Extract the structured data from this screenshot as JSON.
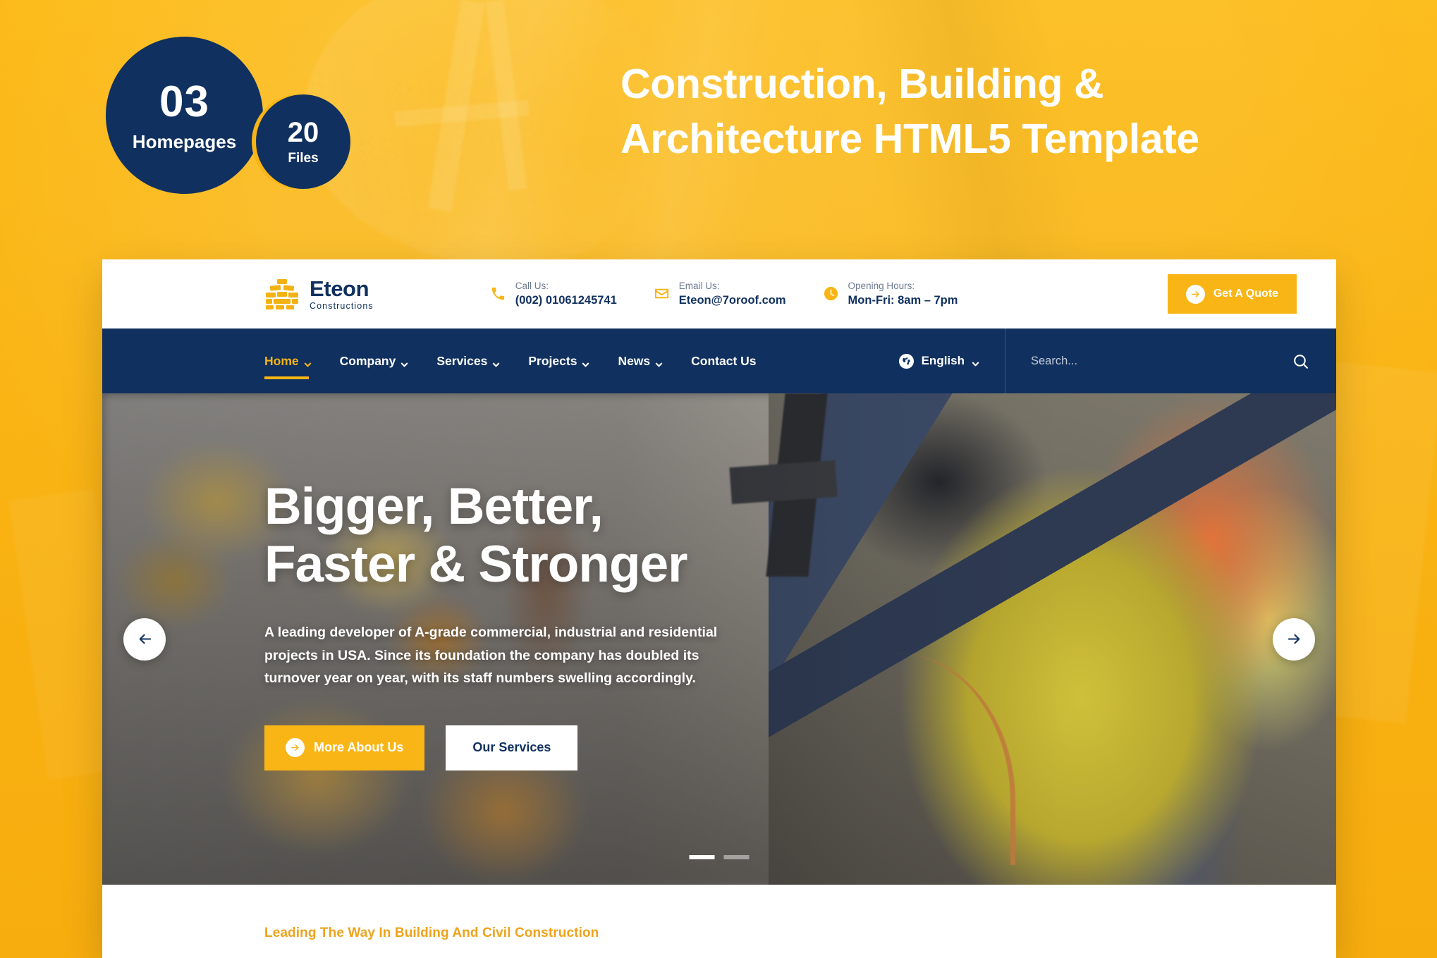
{
  "promo": {
    "badge_primary": {
      "number": "03",
      "label": "Homepages"
    },
    "badge_secondary": {
      "number": "20",
      "label": "Files"
    },
    "title_line1": "Construction, Building &",
    "title_line2": "Architecture HTML5 Template",
    "background_color": "#f9b515",
    "badge_color": "#10305f"
  },
  "site": {
    "logo": {
      "name": "Eteon",
      "tagline": "Constructions",
      "icon": "brick-wall-icon"
    },
    "contacts": [
      {
        "icon": "phone-icon",
        "label": "Call Us:",
        "value": "(002) 01061245741"
      },
      {
        "icon": "mail-icon",
        "label": "Email Us:",
        "value": "Eteon@7oroof.com"
      },
      {
        "icon": "clock-icon",
        "label": "Opening Hours:",
        "value": "Mon-Fri: 8am – 7pm"
      }
    ],
    "quote_button": "Get A Quote",
    "nav": [
      {
        "label": "Home",
        "has_dropdown": true,
        "active": true
      },
      {
        "label": "Company",
        "has_dropdown": true,
        "active": false
      },
      {
        "label": "Services",
        "has_dropdown": true,
        "active": false
      },
      {
        "label": "Projects",
        "has_dropdown": true,
        "active": false
      },
      {
        "label": "News",
        "has_dropdown": true,
        "active": false
      },
      {
        "label": "Contact Us",
        "has_dropdown": false,
        "active": false
      }
    ],
    "language": {
      "label": "English",
      "icon": "globe-icon"
    },
    "search": {
      "placeholder": "Search...",
      "value": "",
      "icon": "search-icon"
    },
    "accent_color": "#f9b515",
    "navbar_color": "#10305f"
  },
  "hero": {
    "title_line1": "Bigger, Better,",
    "title_line2": "Faster & Stronger",
    "description": "A leading developer of A-grade commercial, industrial and residential projects in USA. Since its foundation the company has doubled its turnover year on year, with its staff numbers swelling accordingly.",
    "primary_button": "More About Us",
    "secondary_button": "Our Services",
    "prev_label": "Previous slide",
    "next_label": "Next slide",
    "slides": 2,
    "active_slide": 1
  },
  "section": {
    "eyebrow": "Leading The Way In Building And Civil Construction"
  }
}
